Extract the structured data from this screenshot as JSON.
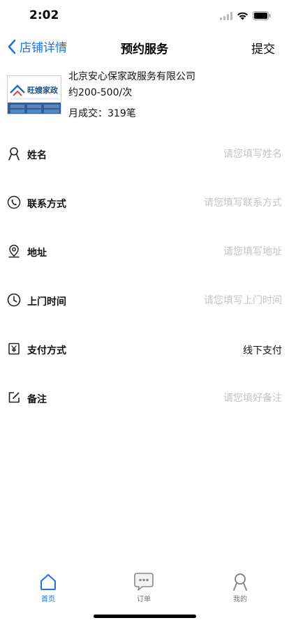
{
  "status_bar": {
    "time": "2:02"
  },
  "nav": {
    "back_label": "店铺详情",
    "title": "预约服务",
    "submit_label": "提交"
  },
  "shop": {
    "logo_text": "旺嫂家政",
    "name": "北京安心保家政服务有限公司",
    "price": "约200-500/次",
    "monthly_deals": "月成交：319笔"
  },
  "form": {
    "rows": [
      {
        "label": "姓名",
        "placeholder": "请您填写姓名",
        "icon": "person-icon"
      },
      {
        "label": "联系方式",
        "placeholder": "请您填写联系方式",
        "icon": "phone-icon"
      },
      {
        "label": "地址",
        "placeholder": "请您填写地址",
        "icon": "location-pin-icon"
      },
      {
        "label": "上门时间",
        "placeholder": "请您填写上门时间",
        "icon": "clock-icon"
      },
      {
        "label": "支付方式",
        "value": "线下支付",
        "icon": "yuan-icon"
      },
      {
        "label": "备注",
        "placeholder": "请您填好备注",
        "icon": "edit-icon"
      }
    ]
  },
  "tabbar": {
    "items": [
      {
        "label": "首页",
        "icon": "home-icon",
        "active": true
      },
      {
        "label": "订单",
        "icon": "chat-bubble-icon",
        "active": false
      },
      {
        "label": "我的",
        "icon": "user-icon",
        "active": false
      }
    ]
  },
  "colors": {
    "accent": "#1a73e8",
    "placeholder": "#c4c4c4",
    "text": "#111111"
  }
}
